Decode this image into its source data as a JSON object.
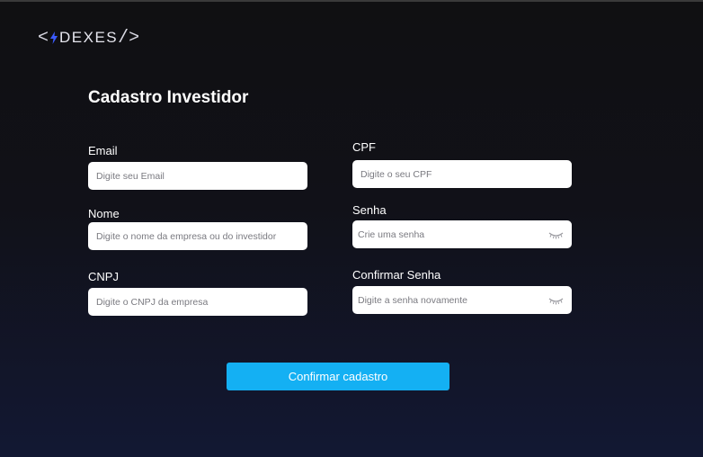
{
  "brand": {
    "open_bracket": "<",
    "name": "DEXES",
    "close_bracket": "/>"
  },
  "page": {
    "title": "Cadastro Investidor"
  },
  "form": {
    "email": {
      "label": "Email",
      "placeholder": "Digite seu Email",
      "value": ""
    },
    "nome": {
      "label": "Nome",
      "placeholder": "Digite o nome da empresa ou do investidor",
      "value": ""
    },
    "cnpj": {
      "label": "CNPJ",
      "placeholder": "Digite o CNPJ da empresa",
      "value": ""
    },
    "cpf": {
      "label": "CPF",
      "placeholder": "Digite o seu CPF",
      "value": ""
    },
    "senha": {
      "label": "Senha",
      "placeholder": "Crie uma senha",
      "value": "",
      "icon": "eye-closed-icon"
    },
    "confirmar_senha": {
      "label": "Confirmar Senha",
      "placeholder": "Digite a senha novamente",
      "value": "",
      "icon": "eye-closed-icon"
    },
    "submit_label": "Confirmar cadastro"
  },
  "colors": {
    "accent": "#14b0f3",
    "bolt": "#3b5bff",
    "background_top": "#101012",
    "background_bottom": "#121833"
  }
}
